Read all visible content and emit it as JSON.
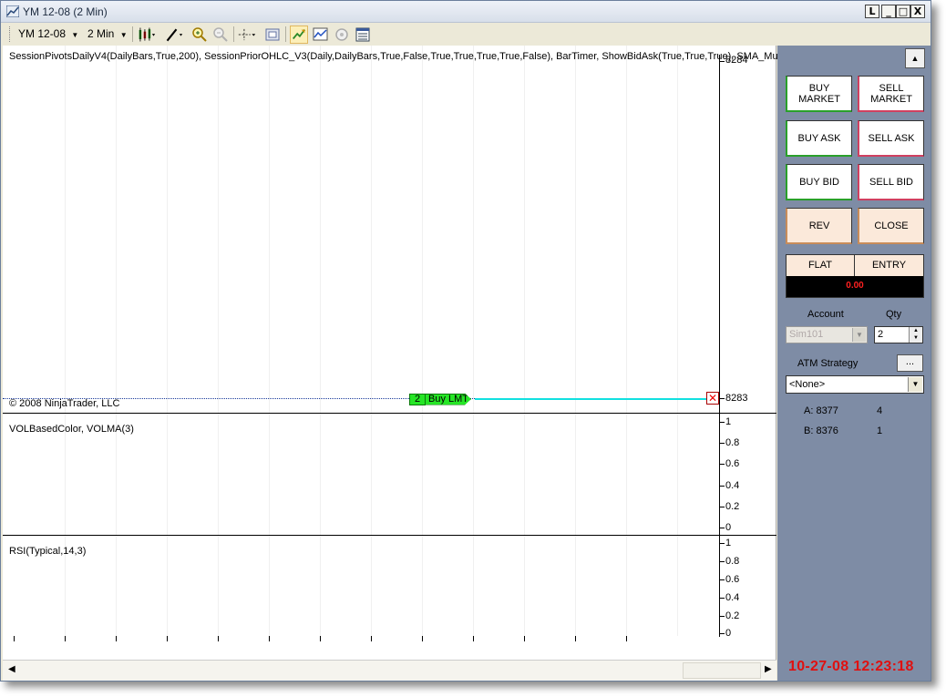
{
  "window": {
    "title": "YM 12-08   (2 Min)",
    "buttons": {
      "link": "L",
      "minimize": "_",
      "maximize": "□",
      "close": "X"
    }
  },
  "toolbar": {
    "instrument": "YM 12-08",
    "interval": "2 Min",
    "icons": [
      "bar-style-icon",
      "draw-pen-icon",
      "zoom-in-icon",
      "zoom-out-icon",
      "crosshair-icon",
      "snapshot-icon",
      "chart-trader-icon",
      "indicators-icon",
      "strategies-icon",
      "properties-icon"
    ]
  },
  "chart": {
    "price_panel_label": "SessionPivotsDailyV4(DailyBars,True,200),  SessionPriorOHLC_V3(Daily,DailyBars,True,False,True,True,True,True,False),  BarTimer,  ShowBidAsk(True,True,True),  SMA_Multi",
    "copyright": "© 2008 NinjaTrader, LLC",
    "price_top": "8284",
    "price_order": "8283",
    "order": {
      "qty": "2",
      "type": "Buy LMT"
    },
    "volume_panel_label": "VOLBasedColor, VOLMA(3)",
    "volume_ticks": [
      "1",
      "0.8",
      "0.6",
      "0.4",
      "0.2",
      "0"
    ],
    "rsi_panel_label": "RSI(Typical,14,3)",
    "rsi_ticks": [
      "1",
      "0.8",
      "0.6",
      "0.4",
      "0.2",
      "0"
    ]
  },
  "chart_trader": {
    "buy_market": "BUY\nMARKET",
    "sell_market": "SELL\nMARKET",
    "buy_ask": "BUY ASK",
    "sell_ask": "SELL ASK",
    "buy_bid": "BUY BID",
    "sell_bid": "SELL BID",
    "rev": "REV",
    "close": "CLOSE",
    "position": {
      "status": "FLAT",
      "entry_label": "ENTRY",
      "pnl": "0.00"
    },
    "account_label": "Account",
    "account_value": "Sim101",
    "qty_label": "Qty",
    "qty_value": "2",
    "atm_label": "ATM Strategy",
    "atm_button": "...",
    "atm_value": "<None>",
    "ask_label": "A: 8377",
    "ask_size": "4",
    "bid_label": "B: 8376",
    "bid_size": "1"
  },
  "clock": "10-27-08 12:23:18",
  "colors": {
    "side_panel": "#7e8ca5",
    "order_marker": "#26e626",
    "order_line": "#12e0e0",
    "pnl_text": "#ff2020",
    "clock_text": "#e01010"
  }
}
